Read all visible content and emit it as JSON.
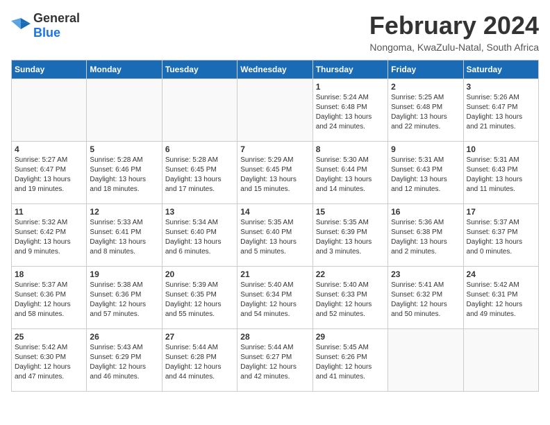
{
  "header": {
    "logo_general": "General",
    "logo_blue": "Blue",
    "month_title": "February 2024",
    "location": "Nongoma, KwaZulu-Natal, South Africa"
  },
  "weekdays": [
    "Sunday",
    "Monday",
    "Tuesday",
    "Wednesday",
    "Thursday",
    "Friday",
    "Saturday"
  ],
  "weeks": [
    [
      {
        "day": "",
        "info": ""
      },
      {
        "day": "",
        "info": ""
      },
      {
        "day": "",
        "info": ""
      },
      {
        "day": "",
        "info": ""
      },
      {
        "day": "1",
        "info": "Sunrise: 5:24 AM\nSunset: 6:48 PM\nDaylight: 13 hours\nand 24 minutes."
      },
      {
        "day": "2",
        "info": "Sunrise: 5:25 AM\nSunset: 6:48 PM\nDaylight: 13 hours\nand 22 minutes."
      },
      {
        "day": "3",
        "info": "Sunrise: 5:26 AM\nSunset: 6:47 PM\nDaylight: 13 hours\nand 21 minutes."
      }
    ],
    [
      {
        "day": "4",
        "info": "Sunrise: 5:27 AM\nSunset: 6:47 PM\nDaylight: 13 hours\nand 19 minutes."
      },
      {
        "day": "5",
        "info": "Sunrise: 5:28 AM\nSunset: 6:46 PM\nDaylight: 13 hours\nand 18 minutes."
      },
      {
        "day": "6",
        "info": "Sunrise: 5:28 AM\nSunset: 6:45 PM\nDaylight: 13 hours\nand 17 minutes."
      },
      {
        "day": "7",
        "info": "Sunrise: 5:29 AM\nSunset: 6:45 PM\nDaylight: 13 hours\nand 15 minutes."
      },
      {
        "day": "8",
        "info": "Sunrise: 5:30 AM\nSunset: 6:44 PM\nDaylight: 13 hours\nand 14 minutes."
      },
      {
        "day": "9",
        "info": "Sunrise: 5:31 AM\nSunset: 6:43 PM\nDaylight: 13 hours\nand 12 minutes."
      },
      {
        "day": "10",
        "info": "Sunrise: 5:31 AM\nSunset: 6:43 PM\nDaylight: 13 hours\nand 11 minutes."
      }
    ],
    [
      {
        "day": "11",
        "info": "Sunrise: 5:32 AM\nSunset: 6:42 PM\nDaylight: 13 hours\nand 9 minutes."
      },
      {
        "day": "12",
        "info": "Sunrise: 5:33 AM\nSunset: 6:41 PM\nDaylight: 13 hours\nand 8 minutes."
      },
      {
        "day": "13",
        "info": "Sunrise: 5:34 AM\nSunset: 6:40 PM\nDaylight: 13 hours\nand 6 minutes."
      },
      {
        "day": "14",
        "info": "Sunrise: 5:35 AM\nSunset: 6:40 PM\nDaylight: 13 hours\nand 5 minutes."
      },
      {
        "day": "15",
        "info": "Sunrise: 5:35 AM\nSunset: 6:39 PM\nDaylight: 13 hours\nand 3 minutes."
      },
      {
        "day": "16",
        "info": "Sunrise: 5:36 AM\nSunset: 6:38 PM\nDaylight: 13 hours\nand 2 minutes."
      },
      {
        "day": "17",
        "info": "Sunrise: 5:37 AM\nSunset: 6:37 PM\nDaylight: 13 hours\nand 0 minutes."
      }
    ],
    [
      {
        "day": "18",
        "info": "Sunrise: 5:37 AM\nSunset: 6:36 PM\nDaylight: 12 hours\nand 58 minutes."
      },
      {
        "day": "19",
        "info": "Sunrise: 5:38 AM\nSunset: 6:36 PM\nDaylight: 12 hours\nand 57 minutes."
      },
      {
        "day": "20",
        "info": "Sunrise: 5:39 AM\nSunset: 6:35 PM\nDaylight: 12 hours\nand 55 minutes."
      },
      {
        "day": "21",
        "info": "Sunrise: 5:40 AM\nSunset: 6:34 PM\nDaylight: 12 hours\nand 54 minutes."
      },
      {
        "day": "22",
        "info": "Sunrise: 5:40 AM\nSunset: 6:33 PM\nDaylight: 12 hours\nand 52 minutes."
      },
      {
        "day": "23",
        "info": "Sunrise: 5:41 AM\nSunset: 6:32 PM\nDaylight: 12 hours\nand 50 minutes."
      },
      {
        "day": "24",
        "info": "Sunrise: 5:42 AM\nSunset: 6:31 PM\nDaylight: 12 hours\nand 49 minutes."
      }
    ],
    [
      {
        "day": "25",
        "info": "Sunrise: 5:42 AM\nSunset: 6:30 PM\nDaylight: 12 hours\nand 47 minutes."
      },
      {
        "day": "26",
        "info": "Sunrise: 5:43 AM\nSunset: 6:29 PM\nDaylight: 12 hours\nand 46 minutes."
      },
      {
        "day": "27",
        "info": "Sunrise: 5:44 AM\nSunset: 6:28 PM\nDaylight: 12 hours\nand 44 minutes."
      },
      {
        "day": "28",
        "info": "Sunrise: 5:44 AM\nSunset: 6:27 PM\nDaylight: 12 hours\nand 42 minutes."
      },
      {
        "day": "29",
        "info": "Sunrise: 5:45 AM\nSunset: 6:26 PM\nDaylight: 12 hours\nand 41 minutes."
      },
      {
        "day": "",
        "info": ""
      },
      {
        "day": "",
        "info": ""
      }
    ]
  ]
}
